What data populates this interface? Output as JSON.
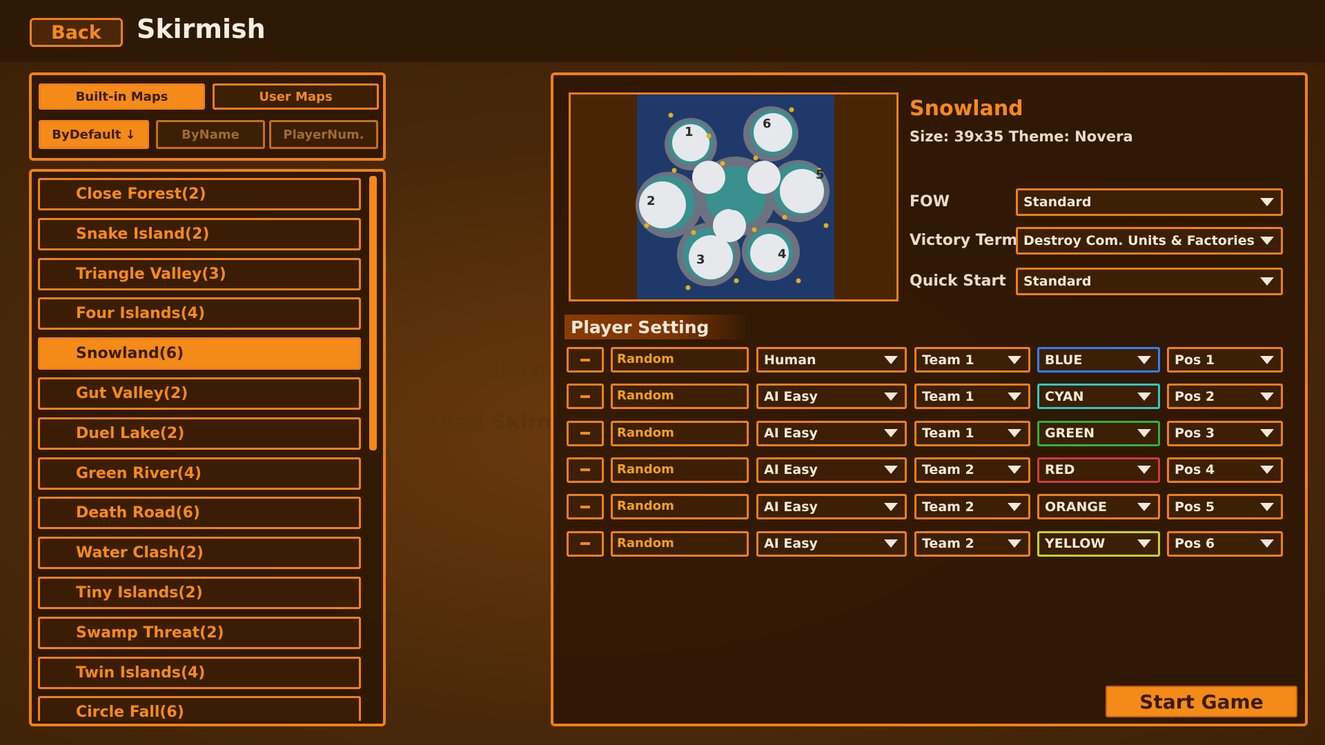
{
  "header": {
    "back_label": "Back",
    "title": "Skirmish"
  },
  "background_ghost": {
    "new_skirmish": "New Skirmi",
    "load_skirmish": "Load Skirmi"
  },
  "map_tabs": [
    {
      "label": "Built-in Maps",
      "active": true
    },
    {
      "label": "User Maps",
      "active": false
    }
  ],
  "sort_buttons": [
    {
      "label": "ByDefault ↓",
      "active": true
    },
    {
      "label": "ByName",
      "active": false
    },
    {
      "label": "PlayerNum.",
      "active": false
    }
  ],
  "maps": [
    {
      "label": "Close Forest(2)",
      "selected": false
    },
    {
      "label": "Snake Island(2)",
      "selected": false
    },
    {
      "label": "Triangle Valley(3)",
      "selected": false
    },
    {
      "label": "Four Islands(4)",
      "selected": false
    },
    {
      "label": "Snowland(6)",
      "selected": true
    },
    {
      "label": "Gut Valley(2)",
      "selected": false
    },
    {
      "label": "Duel Lake(2)",
      "selected": false
    },
    {
      "label": "Green River(4)",
      "selected": false
    },
    {
      "label": "Death Road(6)",
      "selected": false
    },
    {
      "label": "Water Clash(2)",
      "selected": false
    },
    {
      "label": "Tiny Islands(2)",
      "selected": false
    },
    {
      "label": "Swamp Threat(2)",
      "selected": false
    },
    {
      "label": "Twin Islands(4)",
      "selected": false
    },
    {
      "label": "Circle Fall(6)",
      "selected": false
    }
  ],
  "selected_map": {
    "name": "Snowland",
    "meta": "Size: 39x35 Theme: Novera",
    "start_positions": [
      "1",
      "2",
      "3",
      "4",
      "5",
      "6"
    ]
  },
  "options": [
    {
      "label": "FOW",
      "value": "Standard"
    },
    {
      "label": "Victory Term",
      "value": "Destroy Com. Units & Factories"
    },
    {
      "label": "Quick Start",
      "value": "Standard"
    }
  ],
  "player_setting": {
    "title": "Player Setting",
    "remove_symbol": "−",
    "players": [
      {
        "name": "Random",
        "type": "Human",
        "team": "Team 1",
        "color": "BLUE",
        "color_hex": "#2f7fff",
        "pos": "Pos 1"
      },
      {
        "name": "Random",
        "type": "AI Easy",
        "team": "Team 1",
        "color": "CYAN",
        "color_hex": "#33c6c6",
        "pos": "Pos 2"
      },
      {
        "name": "Random",
        "type": "AI Easy",
        "team": "Team 1",
        "color": "GREEN",
        "color_hex": "#2fb23a",
        "pos": "Pos 3"
      },
      {
        "name": "Random",
        "type": "AI Easy",
        "team": "Team 2",
        "color": "RED",
        "color_hex": "#d23a3a",
        "pos": "Pos 4"
      },
      {
        "name": "Random",
        "type": "AI Easy",
        "team": "Team 2",
        "color": "ORANGE",
        "color_hex": "#f08018",
        "pos": "Pos 5"
      },
      {
        "name": "Random",
        "type": "AI Easy",
        "team": "Team 2",
        "color": "YELLOW",
        "color_hex": "#c9d12a",
        "pos": "Pos 6"
      }
    ]
  },
  "start_label": "Start Game"
}
